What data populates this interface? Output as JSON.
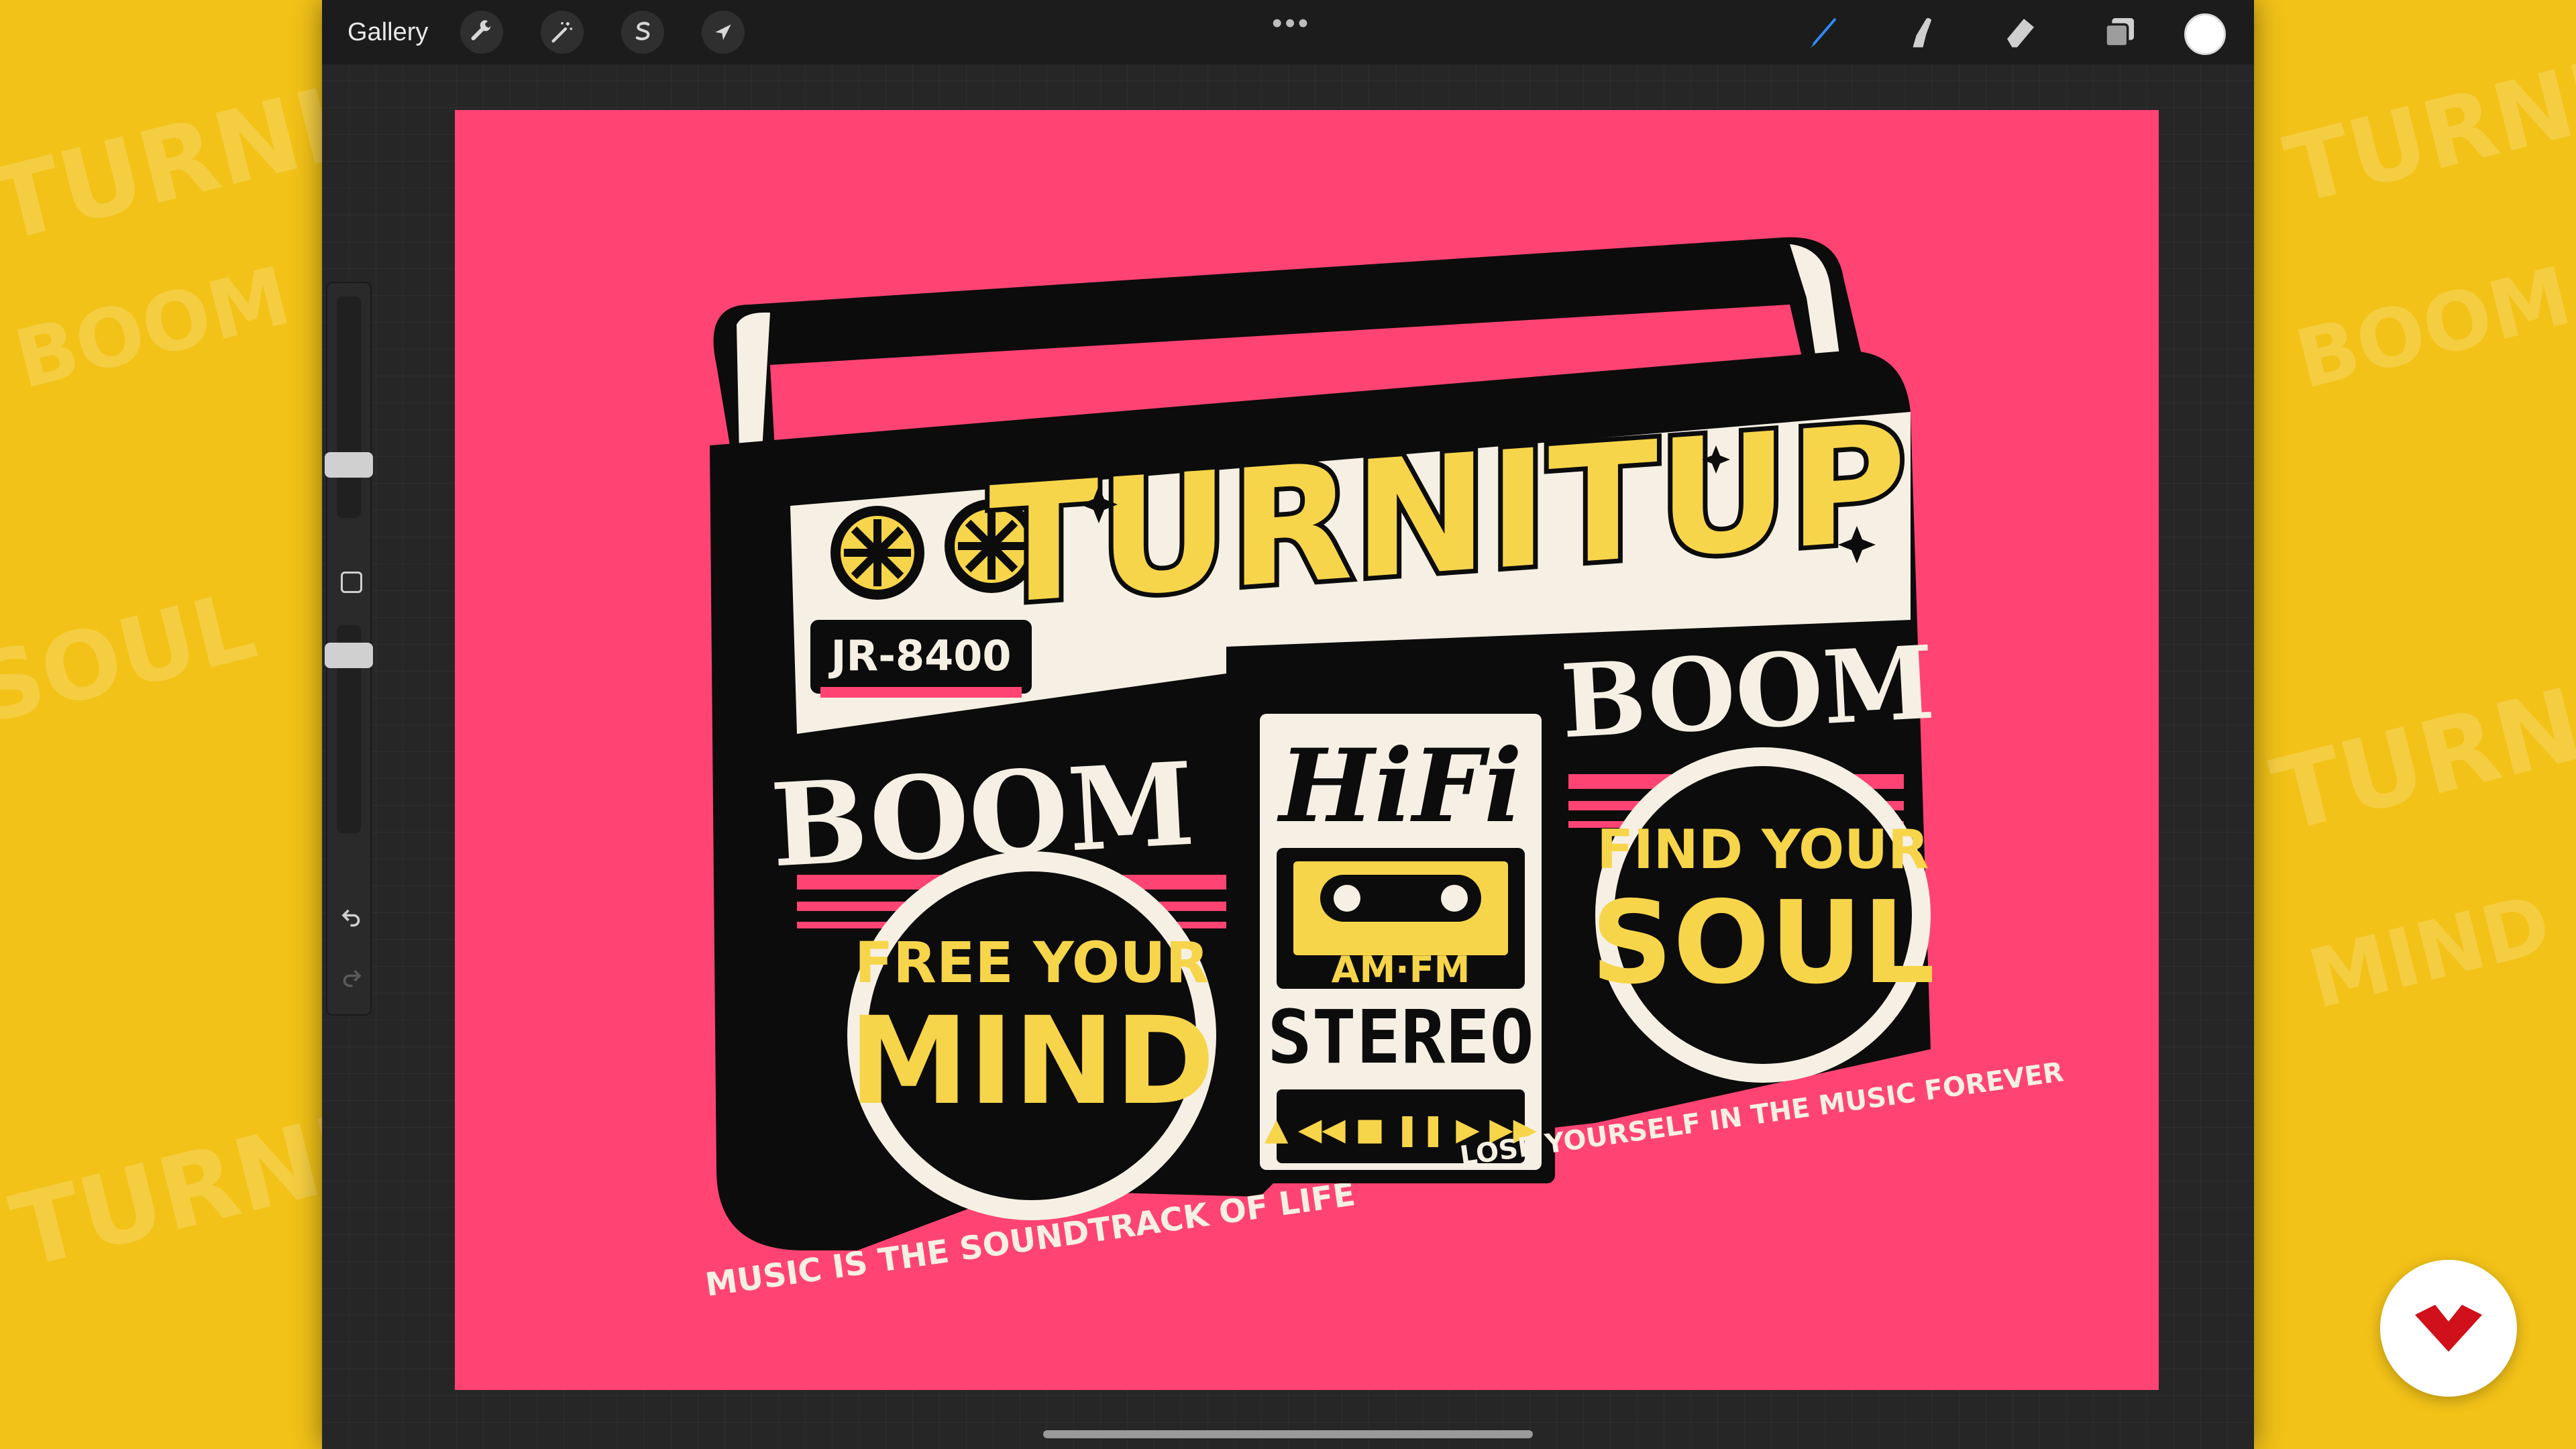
{
  "topbar": {
    "gallery_label": "Gallery",
    "more_dots": "•••"
  },
  "icons": {
    "actions": "wrench-icon",
    "adjustments": "magic-wand-icon",
    "selection": "selection-s-icon",
    "transform": "arrow-cursor-icon",
    "brush": "brush-icon",
    "smudge": "smudge-finger-icon",
    "eraser": "eraser-icon",
    "layers": "layers-icon",
    "undo": "undo-icon",
    "redo": "redo-icon"
  },
  "colors": {
    "canvas_bg": "#ff4473",
    "accent_blue": "#2f8cff",
    "artwork_yellow": "#f7d54a",
    "current_color": "#ffffff"
  },
  "artwork": {
    "model": "JR-8400",
    "headline": "TURNITUP",
    "left_speaker_label": "BOOM",
    "right_speaker_label": "BOOM",
    "center_script": "HiFi",
    "radio_band": "AM·FM",
    "stereo": "STEREO",
    "left_speaker_line1": "FREE YOUR",
    "left_speaker_line2": "MIND",
    "left_arc": "MUSIC IS THE SOUNDTRACK OF LIFE",
    "right_speaker_line1": "FIND YOUR",
    "right_speaker_line2": "SOUL",
    "right_arc": "LOSE YOURSELF IN THE MUSIC FOREVER",
    "transport": "▲ ◀◀ ■ ❚❚ ▶ ▶▶"
  }
}
